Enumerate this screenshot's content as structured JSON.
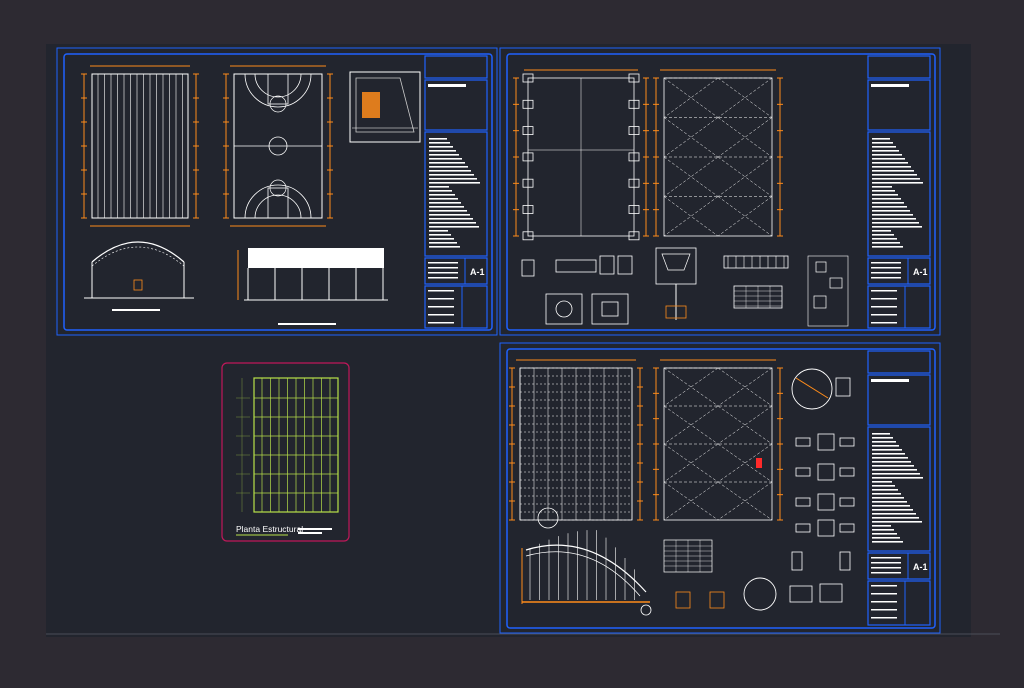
{
  "sheet_tags": {
    "s1": "A-1",
    "s2": "A-1",
    "s3": "A-1"
  },
  "standalone_view": {
    "title": "Planta Estructural"
  },
  "colors": {
    "background": "#2d2a32",
    "model_space": "#22252e",
    "sheet_border": "#1f62ff",
    "dimension": "#ff8c1a",
    "linework": "#ffffff",
    "structure": "#b8e14a",
    "viewport_border": "#c0185a"
  }
}
